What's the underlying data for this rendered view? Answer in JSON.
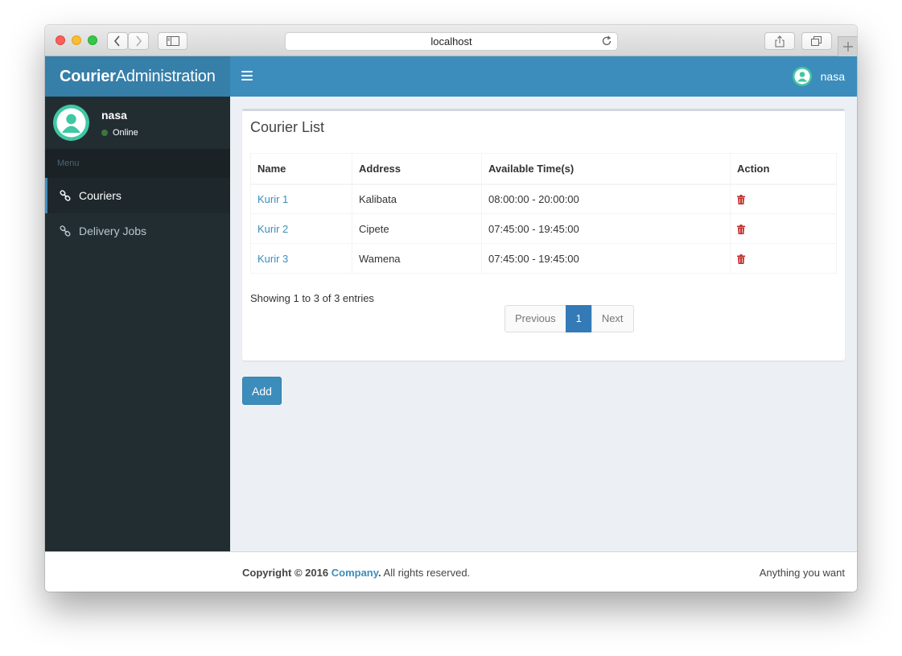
{
  "browser": {
    "url": "localhost"
  },
  "app": {
    "logo_bold": "Courier",
    "logo_rest": "Administration"
  },
  "navbar": {
    "username": "nasa"
  },
  "sidebar": {
    "user": {
      "name": "nasa",
      "status": "Online"
    },
    "menu_header": "Menu",
    "items": [
      {
        "label": "Couriers",
        "icon": "link-icon",
        "active": true
      },
      {
        "label": "Delivery Jobs",
        "icon": "link-icon",
        "active": false
      }
    ]
  },
  "main": {
    "box_title": "Courier List",
    "table": {
      "headers": [
        "Name",
        "Address",
        "Available Time(s)",
        "Action"
      ],
      "rows": [
        {
          "name": "Kurir 1",
          "address": "Kalibata",
          "time": "08:00:00 - 20:00:00",
          "action_icon": "trash-icon"
        },
        {
          "name": "Kurir 2",
          "address": "Cipete",
          "time": "07:45:00 - 19:45:00",
          "action_icon": "trash-icon"
        },
        {
          "name": "Kurir 3",
          "address": "Wamena",
          "time": "07:45:00 - 19:45:00",
          "action_icon": "trash-icon"
        }
      ]
    },
    "info": "Showing 1 to 3 of 3 entries",
    "pagination": {
      "previous": "Previous",
      "current": "1",
      "next": "Next"
    },
    "add_label": "Add"
  },
  "footer": {
    "copyright_prefix": "Copyright © 2016",
    "company": "Company",
    "suffix": ". All rights reserved.",
    "right_text": "Anything you want"
  },
  "colors": {
    "header_blue": "#3c8dbc",
    "logo_blue": "#367fa9",
    "sidebar_dark": "#222d32",
    "avatar_teal": "#3fc8a3",
    "danger": "#dd4b39"
  }
}
